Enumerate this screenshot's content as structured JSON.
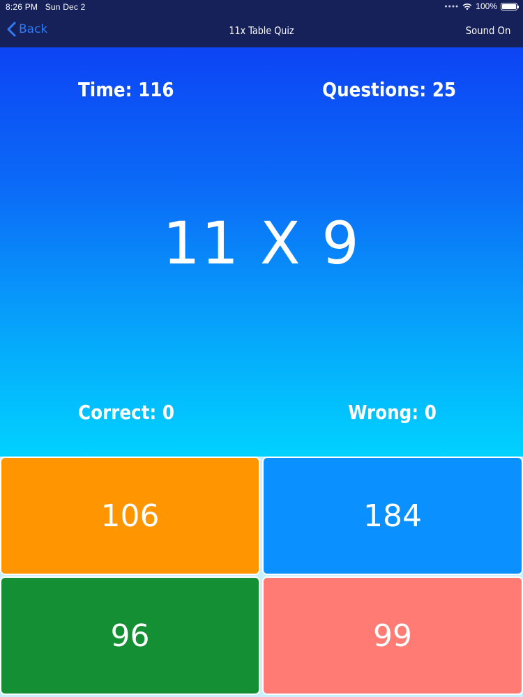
{
  "status_bar": {
    "time": "8:26 PM",
    "date": "Sun Dec 2",
    "battery": "100%",
    "icons": [
      "signal-dots-icon",
      "wifi-icon",
      "battery-icon"
    ]
  },
  "nav": {
    "back_label": "Back",
    "title": "11x Table Quiz",
    "sound_label": "Sound On",
    "back_color": "#2f7cf6",
    "bar_color": "#16215a"
  },
  "stats": {
    "time": "Time: 116",
    "questions": "Questions: 25",
    "correct": "Correct: 0",
    "wrong": "Wrong: 0"
  },
  "question": {
    "text": "11 X 9"
  },
  "answers": [
    {
      "label": "106",
      "color": "#ff9500"
    },
    {
      "label": "184",
      "color": "#0a90ff"
    },
    {
      "label": "96",
      "color": "#148f34"
    },
    {
      "label": "99",
      "color": "#ff7b74"
    }
  ],
  "colors": {
    "gradient_top": "#0d44f5",
    "gradient_bottom": "#00d2ff"
  }
}
